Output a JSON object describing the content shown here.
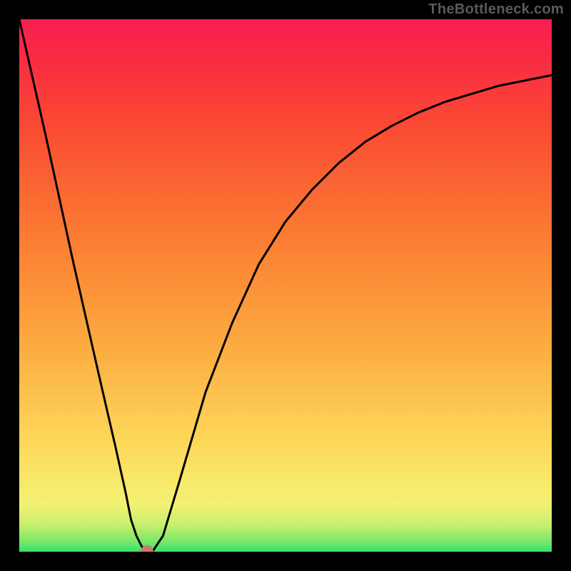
{
  "watermark": "TheBottleneck.com",
  "chart_data": {
    "type": "line",
    "title": "",
    "xlabel": "",
    "ylabel": "",
    "xlim": [
      0,
      100
    ],
    "ylim": [
      0,
      100
    ],
    "series": [
      {
        "name": "curve",
        "x": [
          0,
          5,
          10,
          15,
          18,
          20,
          21,
          22,
          23,
          24,
          25,
          27,
          30,
          35,
          40,
          45,
          50,
          55,
          60,
          65,
          70,
          75,
          80,
          85,
          90,
          95,
          100
        ],
        "y": [
          100,
          78,
          55,
          33,
          20,
          11,
          6,
          3,
          1,
          0,
          0,
          3,
          13,
          30,
          43,
          54,
          62,
          68,
          73,
          77,
          80,
          82.5,
          84.5,
          86,
          87.5,
          88.5,
          89.5
        ]
      }
    ],
    "marker": {
      "x": 24,
      "y": 0
    },
    "background_gradient": {
      "stops": [
        {
          "pos": 0.0,
          "color": "#35e26b"
        },
        {
          "pos": 0.02,
          "color": "#7be86a"
        },
        {
          "pos": 0.05,
          "color": "#c7ef6d"
        },
        {
          "pos": 0.09,
          "color": "#f4f173"
        },
        {
          "pos": 0.2,
          "color": "#fdd95a"
        },
        {
          "pos": 0.4,
          "color": "#fca83f"
        },
        {
          "pos": 0.6,
          "color": "#fb7a32"
        },
        {
          "pos": 0.8,
          "color": "#fa4a33"
        },
        {
          "pos": 0.93,
          "color": "#f92a44"
        },
        {
          "pos": 1.0,
          "color": "#f81e51"
        }
      ]
    }
  }
}
